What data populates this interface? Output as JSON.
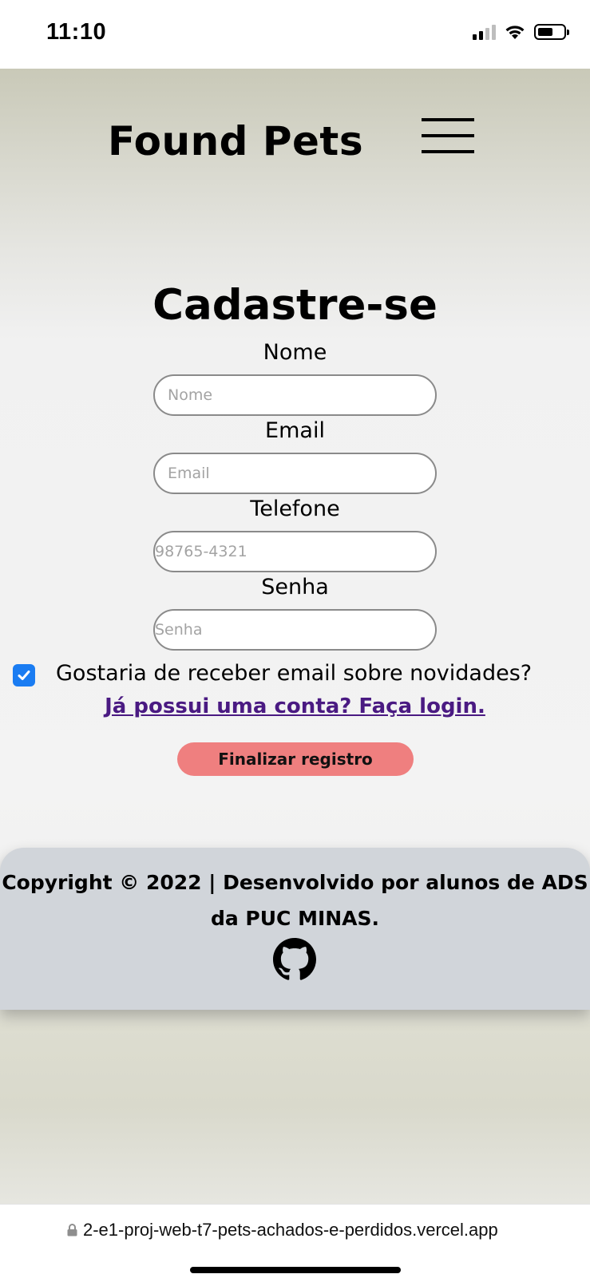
{
  "status_bar": {
    "time": "11:10"
  },
  "header": {
    "brand": "Found Pets"
  },
  "form": {
    "title": "Cadastre-se",
    "name_label": "Nome",
    "name_placeholder": "Nome",
    "email_label": "Email",
    "email_placeholder": "Email",
    "phone_label": "Telefone",
    "phone_placeholder": "98765-4321",
    "password_label": "Senha",
    "password_placeholder": "Senha",
    "newsletter_label": "Gostaria de receber email sobre novidades?",
    "newsletter_checked": true,
    "login_link": "Já possui uma conta? Faça login.",
    "submit_label": "Finalizar registro"
  },
  "footer": {
    "copyright_line1": "Copyright © 2022 | Desenvolvido por alunos de ADS",
    "copyright_line2": "da PUC MINAS.",
    "icon": "github-icon"
  },
  "browser": {
    "url": "2-e1-proj-web-t7-pets-achados-e-perdidos.vercel.app"
  },
  "colors": {
    "accent_button": "#ef7f7f",
    "link": "#4a1a82",
    "checkbox": "#1a7cf2",
    "footer_bg": "#d1d5da"
  }
}
